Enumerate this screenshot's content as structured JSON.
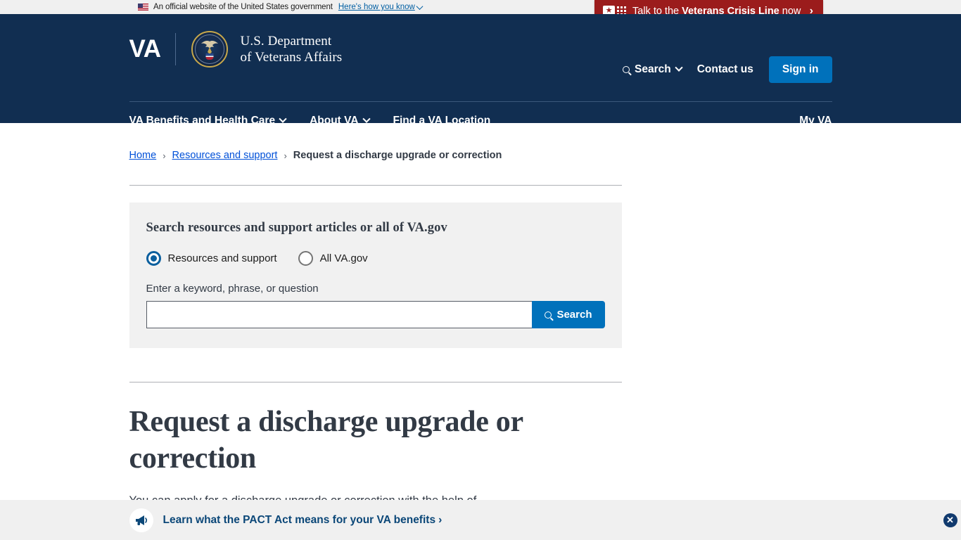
{
  "gov_banner": {
    "flag_icon": "us-flag-icon",
    "text": "An official website of the United States government",
    "how_you_know": "Here's how you know"
  },
  "crisis_banner": {
    "icon": "crisis-chat-icon",
    "prefix": "Talk to the ",
    "emphasis": "Veterans Crisis Line",
    "suffix": " now",
    "arrow": "›",
    "background_color": "#9b1c1c"
  },
  "header": {
    "va_mark": "VA",
    "seal_icon": "va-seal-icon",
    "department_line1": "U.S. Department",
    "department_line2": "of Veterans Affairs",
    "search_label": "Search",
    "contact_label": "Contact us",
    "signin_label": "Sign in",
    "background_color": "#112e51",
    "accent_color": "#0071bb"
  },
  "mainnav": {
    "items": [
      {
        "label": "VA Benefits and Health Care",
        "has_chevron": true
      },
      {
        "label": "About VA",
        "has_chevron": true
      },
      {
        "label": "Find a VA Location",
        "has_chevron": false
      }
    ],
    "myva_label": "My VA"
  },
  "breadcrumb": {
    "home": "Home",
    "section": "Resources and support",
    "separator": "›",
    "current": "Request a discharge upgrade or correction"
  },
  "search_panel": {
    "heading": "Search resources and support articles or all of VA.gov",
    "options": [
      {
        "label": "Resources and support",
        "selected": true
      },
      {
        "label": "All VA.gov",
        "selected": false
      }
    ],
    "field_label": "Enter a keyword, phrase, or question",
    "input_value": "",
    "input_placeholder": "",
    "search_button": "Search",
    "search_icon": "search-icon",
    "background_color": "#f1f1f1"
  },
  "main": {
    "title": "Request a discharge upgrade or correction",
    "body": "You can apply for a discharge upgrade or correction with the help of…"
  },
  "pact_banner": {
    "icon": "megaphone-icon",
    "link_text": "Learn what the PACT Act means for your VA benefits",
    "link_arrow": "›",
    "close_icon": "close-icon",
    "close_glyph": "✕",
    "background_color": "#f0f0f0"
  }
}
